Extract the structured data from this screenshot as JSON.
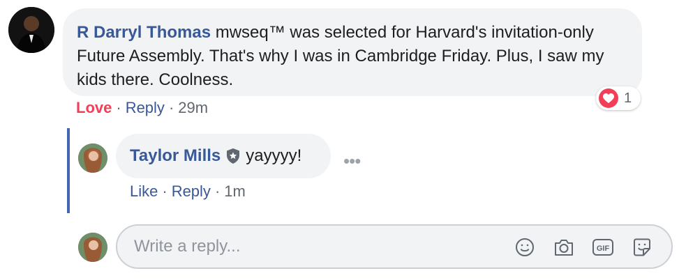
{
  "main_comment": {
    "author": "R Darryl Thomas",
    "text": "mwseq™ was selected for Harvard's invitation-only Future Assembly. That's why I was in Cambridge Friday. Plus, I saw my kids there. Coolness.",
    "reaction": {
      "icon": "heart-icon",
      "count": "1"
    },
    "actions": {
      "love": "Love",
      "reply": "Reply",
      "time": "29m"
    }
  },
  "reply_comment": {
    "author": "Taylor Mills",
    "text": "yayyyy!",
    "more": "•••",
    "actions": {
      "like": "Like",
      "reply": "Reply",
      "time": "1m"
    }
  },
  "reply_box": {
    "placeholder": "Write a reply...",
    "tools": [
      "emoji-icon",
      "camera-icon",
      "gif-icon",
      "sticker-icon"
    ]
  },
  "colors": {
    "name": "#385898",
    "love": "#f33e58",
    "thread": "#4267b2"
  }
}
